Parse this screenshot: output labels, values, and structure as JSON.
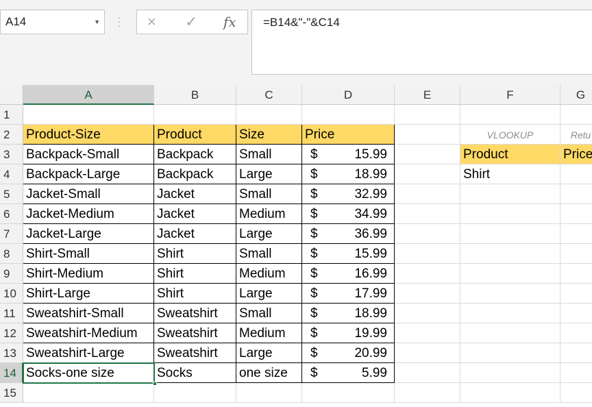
{
  "name_box": "A14",
  "formula": "=B14&\"-\"&C14",
  "icons": {
    "cancel": "×",
    "enter": "✓",
    "fx": "fx",
    "dropdown": "▼"
  },
  "colors": {
    "header_fill": "#ffd966",
    "selection": "#217346"
  },
  "columns": [
    "A",
    "B",
    "C",
    "D",
    "E",
    "F",
    "G"
  ],
  "rows": [
    "1",
    "2",
    "3",
    "4",
    "5",
    "6",
    "7",
    "8",
    "9",
    "10",
    "11",
    "12",
    "13",
    "14",
    "15"
  ],
  "table": {
    "headers": {
      "product_size": "Product-Size",
      "product": "Product",
      "size": "Size",
      "price": "Price"
    },
    "rows": [
      {
        "a": "Backpack-Small",
        "b": "Backpack",
        "c": "Small",
        "cur": "$",
        "d": "15.99"
      },
      {
        "a": "Backpack-Large",
        "b": "Backpack",
        "c": "Large",
        "cur": "$",
        "d": "18.99"
      },
      {
        "a": "Jacket-Small",
        "b": "Jacket",
        "c": "Small",
        "cur": "$",
        "d": "32.99"
      },
      {
        "a": "Jacket-Medium",
        "b": "Jacket",
        "c": "Medium",
        "cur": "$",
        "d": "34.99"
      },
      {
        "a": "Jacket-Large",
        "b": "Jacket",
        "c": "Large",
        "cur": "$",
        "d": "36.99"
      },
      {
        "a": "Shirt-Small",
        "b": "Shirt",
        "c": "Small",
        "cur": "$",
        "d": "15.99"
      },
      {
        "a": "Shirt-Medium",
        "b": "Shirt",
        "c": "Medium",
        "cur": "$",
        "d": "16.99"
      },
      {
        "a": "Shirt-Large",
        "b": "Shirt",
        "c": "Large",
        "cur": "$",
        "d": "17.99"
      },
      {
        "a": "Sweatshirt-Small",
        "b": "Sweatshirt",
        "c": "Small",
        "cur": "$",
        "d": "18.99"
      },
      {
        "a": "Sweatshirt-Medium",
        "b": "Sweatshirt",
        "c": "Medium",
        "cur": "$",
        "d": "19.99"
      },
      {
        "a": "Sweatshirt-Large",
        "b": "Sweatshirt",
        "c": "Large",
        "cur": "$",
        "d": "20.99"
      },
      {
        "a": "Socks-one size",
        "b": "Socks",
        "c": "one size",
        "cur": "$",
        "d": "5.99"
      }
    ]
  },
  "lookup": {
    "vlookup_label": "VLOOKUP",
    "return_label": "Retu",
    "product_header": "Product",
    "price_header": "Price",
    "product_value": "Shirt"
  }
}
